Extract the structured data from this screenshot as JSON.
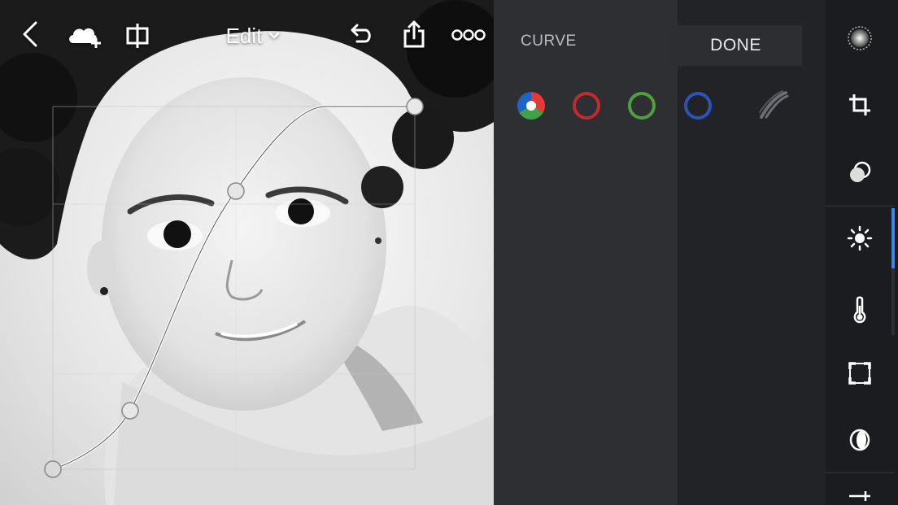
{
  "toolbar": {
    "edit_label": "Edit"
  },
  "panel": {
    "title": "CURVE",
    "done_label": "DONE"
  },
  "channels": [
    {
      "name": "rgb"
    },
    {
      "name": "red",
      "color": "#c3292e"
    },
    {
      "name": "green",
      "color": "#4f9f3d"
    },
    {
      "name": "blue",
      "color": "#2d52b8"
    },
    {
      "name": "luminance"
    }
  ],
  "tools": [
    {
      "icon": "selective-mask-icon"
    },
    {
      "icon": "crop-icon"
    },
    {
      "icon": "presets-icon"
    },
    {
      "icon": "light-icon",
      "active": true
    },
    {
      "icon": "color-temperature-icon"
    },
    {
      "icon": "effects-icon"
    },
    {
      "icon": "detail-icon"
    },
    {
      "icon": "adjustments-icon"
    }
  ],
  "colors": {
    "accent": "#3a86e8",
    "panel_bg": "#2e2f33",
    "rail_bg": "#1b1c1f"
  }
}
